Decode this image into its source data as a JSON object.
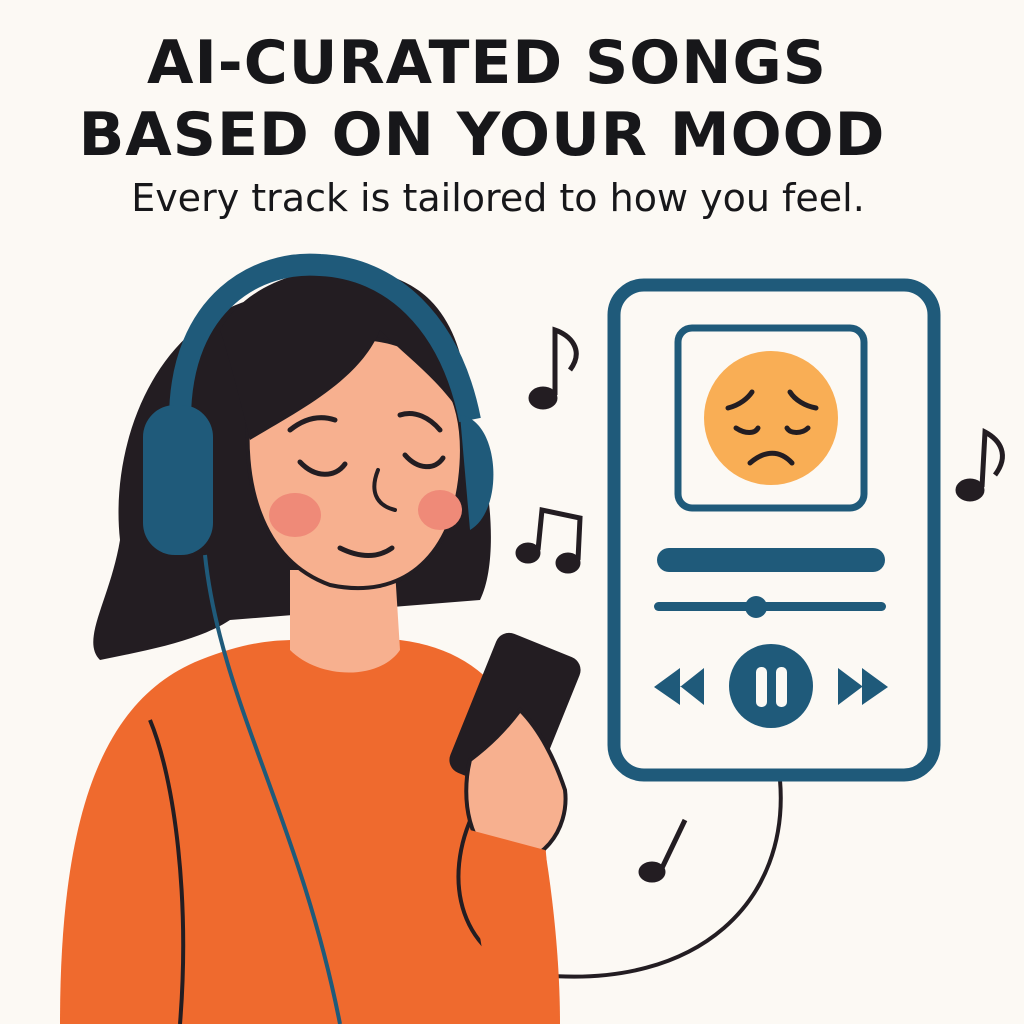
{
  "header": {
    "title_line1": "AI-CURATED SONGS",
    "title_line2": "BASED ON YOUR MOOD",
    "subtitle": "Every track is tailored to how you feel."
  },
  "player": {
    "mood_icon": "sad-face-emoji",
    "progress": 0.44,
    "controls": [
      "rewind-icon",
      "pause-icon",
      "fast-forward-icon"
    ]
  },
  "colors": {
    "background": "#fcf9f4",
    "accent_blue": "#1f5a7a",
    "sweater_orange": "#ef6a2e",
    "skin": "#f7b08f",
    "hair": "#231d22",
    "emoji": "#f9ae55"
  }
}
